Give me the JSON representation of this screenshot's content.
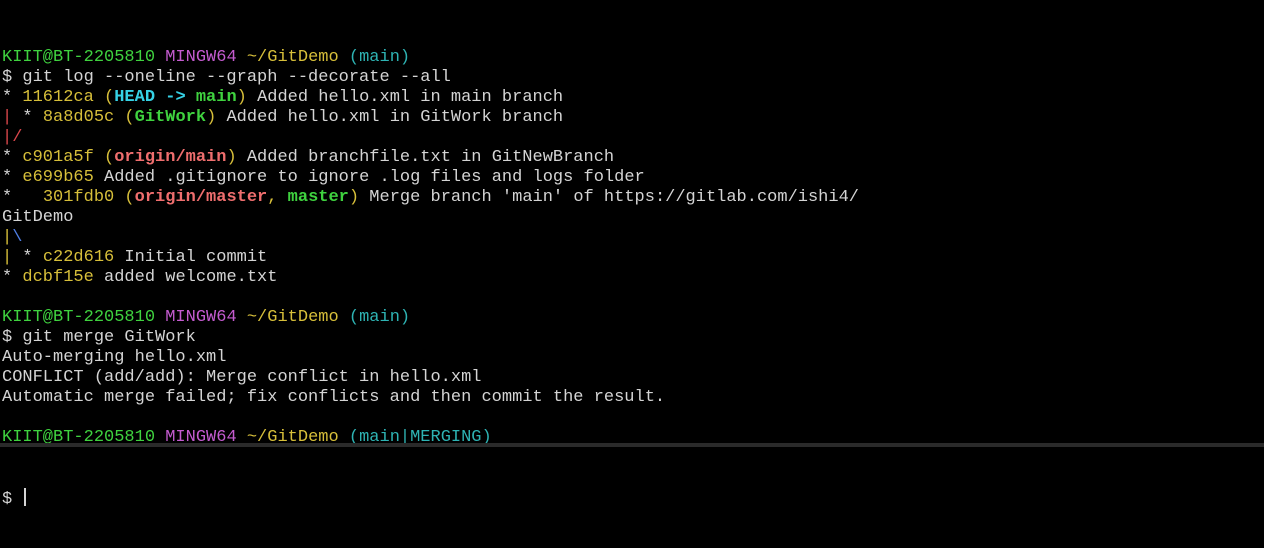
{
  "colors": {
    "default": "#d4d4d4",
    "user_host": "#3fd23f",
    "shell": "#c45bd0",
    "path": "#d7bf3a",
    "branch_prompt": "#2eb3b3",
    "hash": "#d7bf3a",
    "head": "#36d2e6",
    "local_branch": "#3fd23f",
    "remote_branch": "#ef6e6e",
    "graph_red": "#d9464b",
    "graph_yellow": "#d7bf3a",
    "graph_blue": "#4f7fe6"
  },
  "lines": [
    {
      "segments": [
        {
          "text": "KIIT@BT-2205810",
          "color": "user_host"
        },
        {
          "text": " "
        },
        {
          "text": "MINGW64",
          "color": "shell"
        },
        {
          "text": " "
        },
        {
          "text": "~/GitDemo",
          "color": "path"
        },
        {
          "text": " "
        },
        {
          "text": "(main)",
          "color": "branch_prompt"
        }
      ]
    },
    {
      "segments": [
        {
          "text": "$ git log --oneline --graph --decorate --all"
        }
      ]
    },
    {
      "segments": [
        {
          "text": "* "
        },
        {
          "text": "11612ca",
          "color": "hash"
        },
        {
          "text": " (",
          "color": "hash"
        },
        {
          "text": "HEAD -> ",
          "color": "head",
          "bold": true
        },
        {
          "text": "main",
          "color": "local_branch",
          "bold": true
        },
        {
          "text": ")",
          "color": "hash"
        },
        {
          "text": " Added hello.xml in main branch"
        }
      ]
    },
    {
      "segments": [
        {
          "text": "|",
          "color": "graph_red"
        },
        {
          "text": " * "
        },
        {
          "text": "8a8d05c",
          "color": "hash"
        },
        {
          "text": " (",
          "color": "hash"
        },
        {
          "text": "GitWork",
          "color": "local_branch",
          "bold": true
        },
        {
          "text": ")",
          "color": "hash"
        },
        {
          "text": " Added hello.xml in GitWork branch"
        }
      ]
    },
    {
      "segments": [
        {
          "text": "|/",
          "color": "graph_red"
        }
      ]
    },
    {
      "segments": [
        {
          "text": "* "
        },
        {
          "text": "c901a5f",
          "color": "hash"
        },
        {
          "text": " (",
          "color": "hash"
        },
        {
          "text": "origin/main",
          "color": "remote_branch",
          "bold": true
        },
        {
          "text": ")",
          "color": "hash"
        },
        {
          "text": " Added branchfile.txt in GitNewBranch"
        }
      ]
    },
    {
      "segments": [
        {
          "text": "* "
        },
        {
          "text": "e699b65",
          "color": "hash"
        },
        {
          "text": " Added .gitignore to ignore .log files and logs folder"
        }
      ]
    },
    {
      "segments": [
        {
          "text": "*   "
        },
        {
          "text": "301fdb0",
          "color": "hash"
        },
        {
          "text": " (",
          "color": "hash"
        },
        {
          "text": "origin/master",
          "color": "remote_branch",
          "bold": true
        },
        {
          "text": ", ",
          "color": "hash"
        },
        {
          "text": "master",
          "color": "local_branch",
          "bold": true
        },
        {
          "text": ")",
          "color": "hash"
        },
        {
          "text": " Merge branch 'main' of https://gitlab.com/ishi4/"
        }
      ]
    },
    {
      "segments": [
        {
          "text": "GitDemo"
        }
      ]
    },
    {
      "segments": [
        {
          "text": "|",
          "color": "graph_yellow"
        },
        {
          "text": "\\",
          "color": "graph_blue"
        }
      ]
    },
    {
      "segments": [
        {
          "text": "|",
          "color": "graph_yellow"
        },
        {
          "text": " * "
        },
        {
          "text": "c22d616",
          "color": "hash"
        },
        {
          "text": " Initial commit"
        }
      ]
    },
    {
      "segments": [
        {
          "text": "* "
        },
        {
          "text": "dcbf15e",
          "color": "hash"
        },
        {
          "text": " added welcome.txt"
        }
      ]
    },
    {
      "segments": []
    },
    {
      "segments": [
        {
          "text": "KIIT@BT-2205810",
          "color": "user_host"
        },
        {
          "text": " "
        },
        {
          "text": "MINGW64",
          "color": "shell"
        },
        {
          "text": " "
        },
        {
          "text": "~/GitDemo",
          "color": "path"
        },
        {
          "text": " "
        },
        {
          "text": "(main)",
          "color": "branch_prompt"
        }
      ]
    },
    {
      "segments": [
        {
          "text": "$ git merge GitWork"
        }
      ]
    },
    {
      "segments": [
        {
          "text": "Auto-merging hello.xml"
        }
      ]
    },
    {
      "segments": [
        {
          "text": "CONFLICT (add/add): Merge conflict in hello.xml"
        }
      ]
    },
    {
      "segments": [
        {
          "text": "Automatic merge failed; fix conflicts and then commit the result."
        }
      ]
    },
    {
      "segments": []
    },
    {
      "segments": [
        {
          "text": "KIIT@BT-2205810",
          "color": "user_host"
        },
        {
          "text": " "
        },
        {
          "text": "MINGW64",
          "color": "shell"
        },
        {
          "text": " "
        },
        {
          "text": "~/GitDemo",
          "color": "path"
        },
        {
          "text": " "
        },
        {
          "text": "(main|MERGING)",
          "color": "branch_prompt"
        }
      ]
    }
  ],
  "prompt": {
    "symbol": "$ "
  }
}
